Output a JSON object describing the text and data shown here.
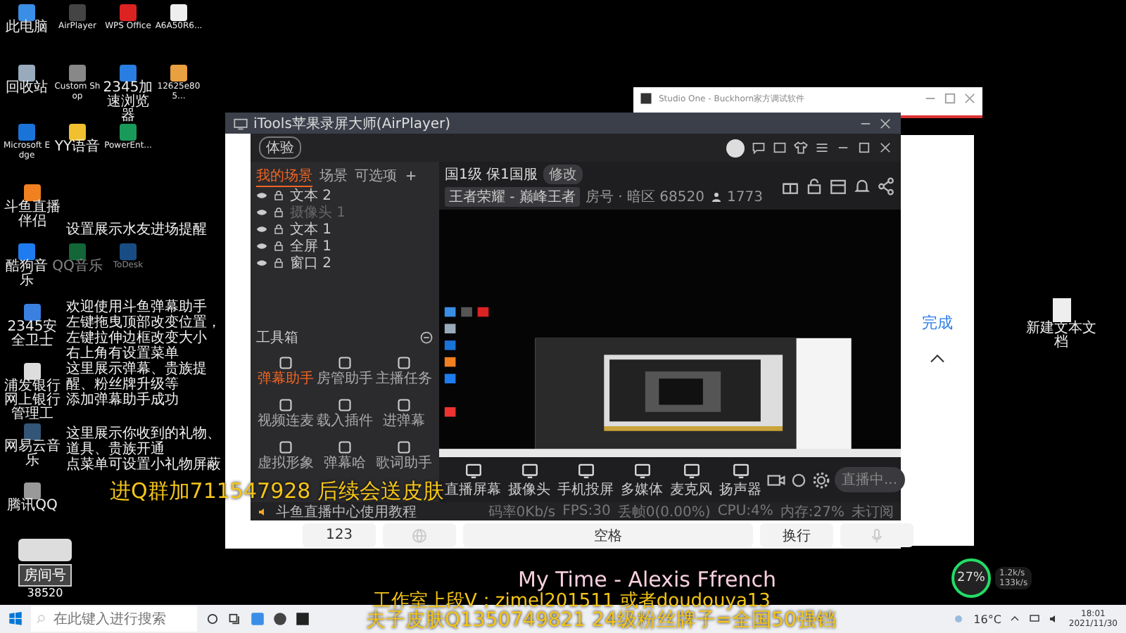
{
  "desktop_icons": [
    {
      "label": "此电脑",
      "faded": false
    },
    {
      "label": "AirPlayer",
      "faded": false
    },
    {
      "label": "WPS Office",
      "faded": false
    },
    {
      "label": "A6A50R6...",
      "faded": false
    },
    {
      "label": "回收站",
      "faded": false
    },
    {
      "label": "Custom Shop",
      "faded": false
    },
    {
      "label": "2345加速浏览器",
      "faded": false
    },
    {
      "label": "12625e805...",
      "faded": false
    },
    {
      "label": "Microsoft Edge",
      "faded": false
    },
    {
      "label": "YY语音",
      "faded": false
    },
    {
      "label": "PowerEnt...",
      "faded": false
    },
    {
      "label": "斗鱼直播伴侣",
      "faded": false
    },
    {
      "label": "酷狗音乐",
      "faded": false
    },
    {
      "label": "QQ音乐",
      "faded": true
    },
    {
      "label": "ToDesk",
      "faded": true
    },
    {
      "label": "2345安全卫士",
      "faded": false
    },
    {
      "label": "浦发银行网上银行管理工",
      "faded": false
    },
    {
      "label": "网易云音乐",
      "faded": false
    },
    {
      "label": "腾讯QQ",
      "faded": false
    }
  ],
  "desktop_notes": [
    [
      "设置展示水友进场提醒"
    ],
    [
      "欢迎使用斗鱼弹幕助手",
      "左键拖曳顶部改变位置，左键拉伸边框改变大小",
      "右上角有设置菜单",
      "这里展示弹幕、贵族提醒、粉丝牌升级等",
      "添加弹幕助手成功"
    ],
    [
      "这里展示你收到的礼物、道具、贵族开通",
      "点菜单可设置小礼物屏蔽"
    ]
  ],
  "studio_window": {
    "title": "Studio One - Buckhorn家方调试软件"
  },
  "phone_panel": {
    "done": "完成",
    "keys": [
      "123",
      "空格",
      "换行"
    ]
  },
  "itools_window": {
    "title": "iTools苹果录屏大师(AirPlayer)"
  },
  "app": {
    "badge": "体验",
    "scene_tabs": [
      {
        "label": "我的场景",
        "selected": true
      },
      {
        "label": "场景",
        "selected": false
      },
      {
        "label": "可选项",
        "selected": false
      }
    ],
    "sources": [
      {
        "label": "文本 2",
        "visible": true
      },
      {
        "label": "摄像头 1",
        "visible": false
      },
      {
        "label": "文本 1",
        "visible": true
      },
      {
        "label": "全屏 1",
        "visible": true
      },
      {
        "label": "窗口 2",
        "visible": true
      }
    ],
    "room_title": "国1级 保1国服",
    "edit": "修改",
    "category": "王者荣耀 - 巅峰王者",
    "room_info": "房号 · 暗区 68520",
    "viewers": "1773",
    "toolbox_title": "工具箱",
    "tools": [
      {
        "label": "弹幕助手",
        "selected": true
      },
      {
        "label": "房管助手",
        "selected": false
      },
      {
        "label": "主播任务",
        "selected": false
      },
      {
        "label": "视频连麦",
        "selected": false
      },
      {
        "label": "载入插件",
        "selected": false
      },
      {
        "label": "进弹幕",
        "selected": false
      },
      {
        "label": "虚拟形象",
        "selected": false
      },
      {
        "label": "弹幕哈",
        "selected": false
      },
      {
        "label": "歌词助手",
        "selected": false
      }
    ],
    "toolbar": [
      "直播屏幕",
      "摄像头",
      "手机投屏",
      "多媒体",
      "麦克风",
      "扬声器"
    ],
    "start_button": "直播中...",
    "status": {
      "tutorial": "斗鱼直播中心使用教程",
      "stats": [
        "码率0Kb/s",
        "FPS:30",
        "丢帧0(0.00%)",
        "CPU:4%",
        "内存:27%",
        "未订阅"
      ]
    }
  },
  "overlays": {
    "qq_group": "进Q群加711547928 后续会送皮肤",
    "song": "My Time - Alexis Ffrench",
    "studio": "工作室上段V；zimel201511 或者doudouya13",
    "skin": "夫子皮肤Q1350749821  24级粉丝牌子=全国50强铛"
  },
  "room_logo": {
    "label": "房间号",
    "number": "38520"
  },
  "desktop_file": "新建文本文档",
  "net_widget": {
    "percent": "27%",
    "up": "1.2k/s",
    "down": "133k/s"
  },
  "taskbar": {
    "search_placeholder": "在此键入进行搜索",
    "weather": "16°C",
    "time": "18:01",
    "date": "2021/11/30"
  }
}
